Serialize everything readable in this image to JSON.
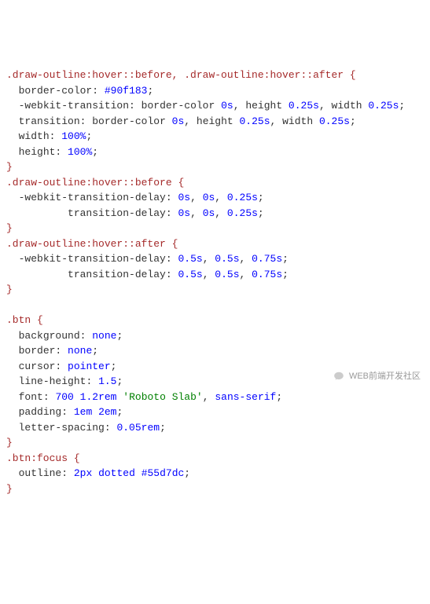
{
  "code": {
    "rule1": {
      "selector": ".draw-outline:hover::before, .draw-outline:hover::after",
      "props": {
        "border_color": {
          "k": "border-color",
          "v": "#90f183"
        },
        "webkit_transition": {
          "k": "-webkit-transition",
          "v_parts": [
            "border-color",
            " 0s",
            ",",
            " height",
            " 0.25s",
            ",",
            " width",
            " 0.25s"
          ]
        },
        "transition": {
          "k": "transition",
          "v_parts": [
            "border-color",
            " 0s",
            ",",
            " height",
            " 0.25s",
            ",",
            " width",
            " 0.25s"
          ]
        },
        "width": {
          "k": "width",
          "v": "100%"
        },
        "height": {
          "k": "height",
          "v": "100%"
        }
      }
    },
    "rule2": {
      "selector": ".draw-outline:hover::before",
      "props": {
        "webkit_delay": {
          "k": "-webkit-transition-delay",
          "v_parts": [
            "0s",
            ",",
            " 0s",
            ",",
            " 0.25s"
          ]
        },
        "delay": {
          "k": "transition-delay",
          "v_parts": [
            "0s",
            ",",
            " 0s",
            ",",
            " 0.25s"
          ]
        }
      }
    },
    "rule3": {
      "selector": ".draw-outline:hover::after",
      "props": {
        "webkit_delay": {
          "k": "-webkit-transition-delay",
          "v_parts": [
            "0.5s",
            ",",
            " 0.5s",
            ",",
            " 0.75s"
          ]
        },
        "delay": {
          "k": "transition-delay",
          "v_parts": [
            "0.5s",
            ",",
            " 0.5s",
            ",",
            " 0.75s"
          ]
        }
      }
    },
    "rule4": {
      "selector": ".btn",
      "props": {
        "background": {
          "k": "background",
          "v": "none"
        },
        "border": {
          "k": "border",
          "v": "none"
        },
        "cursor": {
          "k": "cursor",
          "v": "pointer"
        },
        "line_height": {
          "k": "line-height",
          "v": "1.5"
        },
        "font": {
          "k": "font",
          "v_weight": "700",
          "v_size": "1.2rem",
          "v_family_str": "'Roboto Slab'",
          "v_family_kw": "sans-serif"
        },
        "padding": {
          "k": "padding",
          "v1": "1em",
          "v2": "2em"
        },
        "letter_spacing": {
          "k": "letter-spacing",
          "v": "0.05rem"
        }
      }
    },
    "rule5": {
      "selector": ".btn:focus",
      "props": {
        "outline": {
          "k": "outline",
          "v_size": "2px",
          "v_style": "dotted",
          "v_color": "#55d7dc"
        }
      }
    }
  },
  "watermark": {
    "text": "WEB前端开发社区"
  }
}
